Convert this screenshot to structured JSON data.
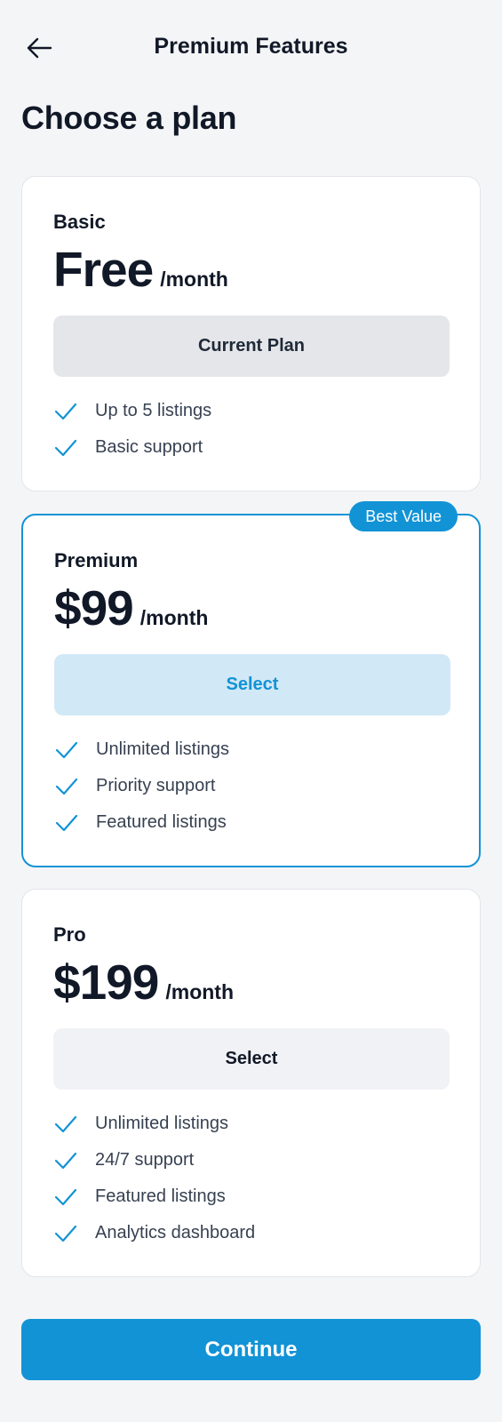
{
  "header": {
    "title": "Premium Features",
    "back_icon": "arrow-left-icon"
  },
  "page": {
    "heading": "Choose a plan"
  },
  "colors": {
    "accent": "#1293d6",
    "accent_light": "#d1e8f6",
    "background": "#f4f5f7",
    "check": "#1293d6"
  },
  "plans": [
    {
      "name": "Basic",
      "price": "Free",
      "period": "/month",
      "button_label": "Current Plan",
      "features": [
        "Up to 5 listings",
        "Basic support"
      ]
    },
    {
      "name": "Premium",
      "price": "$99",
      "period": "/month",
      "badge": "Best Value",
      "button_label": "Select",
      "features": [
        "Unlimited listings",
        "Priority support",
        "Featured listings"
      ]
    },
    {
      "name": "Pro",
      "price": "$199",
      "period": "/month",
      "button_label": "Select",
      "features": [
        "Unlimited listings",
        "24/7 support",
        "Featured listings",
        "Analytics dashboard"
      ]
    }
  ],
  "footer": {
    "continue_label": "Continue"
  }
}
